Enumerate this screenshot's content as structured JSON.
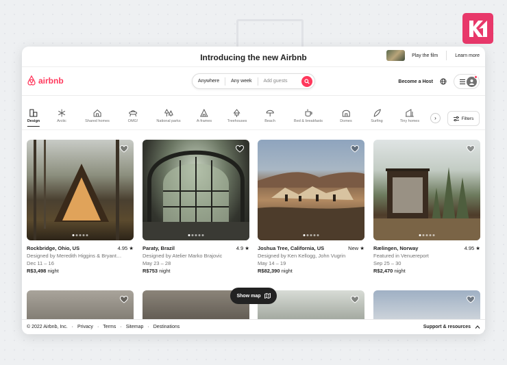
{
  "promo": {
    "title": "Introducing the new Airbnb",
    "play_label": "Play the film",
    "learn_label": "Learn more"
  },
  "header": {
    "brand": "airbnb",
    "search": {
      "where": "Anywhere",
      "when": "Any week",
      "who": "Add guests"
    },
    "host_label": "Become a Host"
  },
  "categories": [
    {
      "label": "Design",
      "icon": "design-icon"
    },
    {
      "label": "Arctic",
      "icon": "snowflake-icon"
    },
    {
      "label": "Shared homes",
      "icon": "house-icon"
    },
    {
      "label": "OMG!",
      "icon": "ufo-icon"
    },
    {
      "label": "National parks",
      "icon": "park-icon"
    },
    {
      "label": "A-frames",
      "icon": "aframe-icon"
    },
    {
      "label": "Treehouses",
      "icon": "tree-icon"
    },
    {
      "label": "Beach",
      "icon": "umbrella-icon"
    },
    {
      "label": "Bed & breakfasts",
      "icon": "coffee-icon"
    },
    {
      "label": "Domes",
      "icon": "dome-icon"
    },
    {
      "label": "Surfing",
      "icon": "surf-icon"
    },
    {
      "label": "Tiny homes",
      "icon": "tiny-home-icon"
    }
  ],
  "filters_label": "Filters",
  "listings": [
    {
      "location": "Rockbridge, Ohio, US",
      "rating": "4.95",
      "host": "Designed by Meredith Higgins & Bryant…",
      "dates": "Dec 11 – 16",
      "price": "R$3,498",
      "unit": "night"
    },
    {
      "location": "Paraty, Brazil",
      "rating": "4.9",
      "host": "Designed by Atelier Marko Brajovic",
      "dates": "May 23 – 28",
      "price": "R$753",
      "unit": "night"
    },
    {
      "location": "Joshua Tree, California, US",
      "rating": "New",
      "host": "Designed by Ken Kellogg, John Vugrin",
      "dates": "May 14 – 19",
      "price": "R$82,390",
      "unit": "night"
    },
    {
      "location": "Rælingen, Norway",
      "rating": "4.95",
      "host": "Featured in Venuereport",
      "dates": "Sep 25 – 30",
      "price": "R$2,470",
      "unit": "night"
    }
  ],
  "show_map_label": "Show map",
  "footer": {
    "copyright": "© 2022 Airbnb, Inc.",
    "links": [
      "Privacy",
      "Terms",
      "Sitemap",
      "Destinations"
    ],
    "support": "Support & resources"
  },
  "colors": {
    "accent": "#ff385c",
    "brand_badge": "#e8386a"
  }
}
